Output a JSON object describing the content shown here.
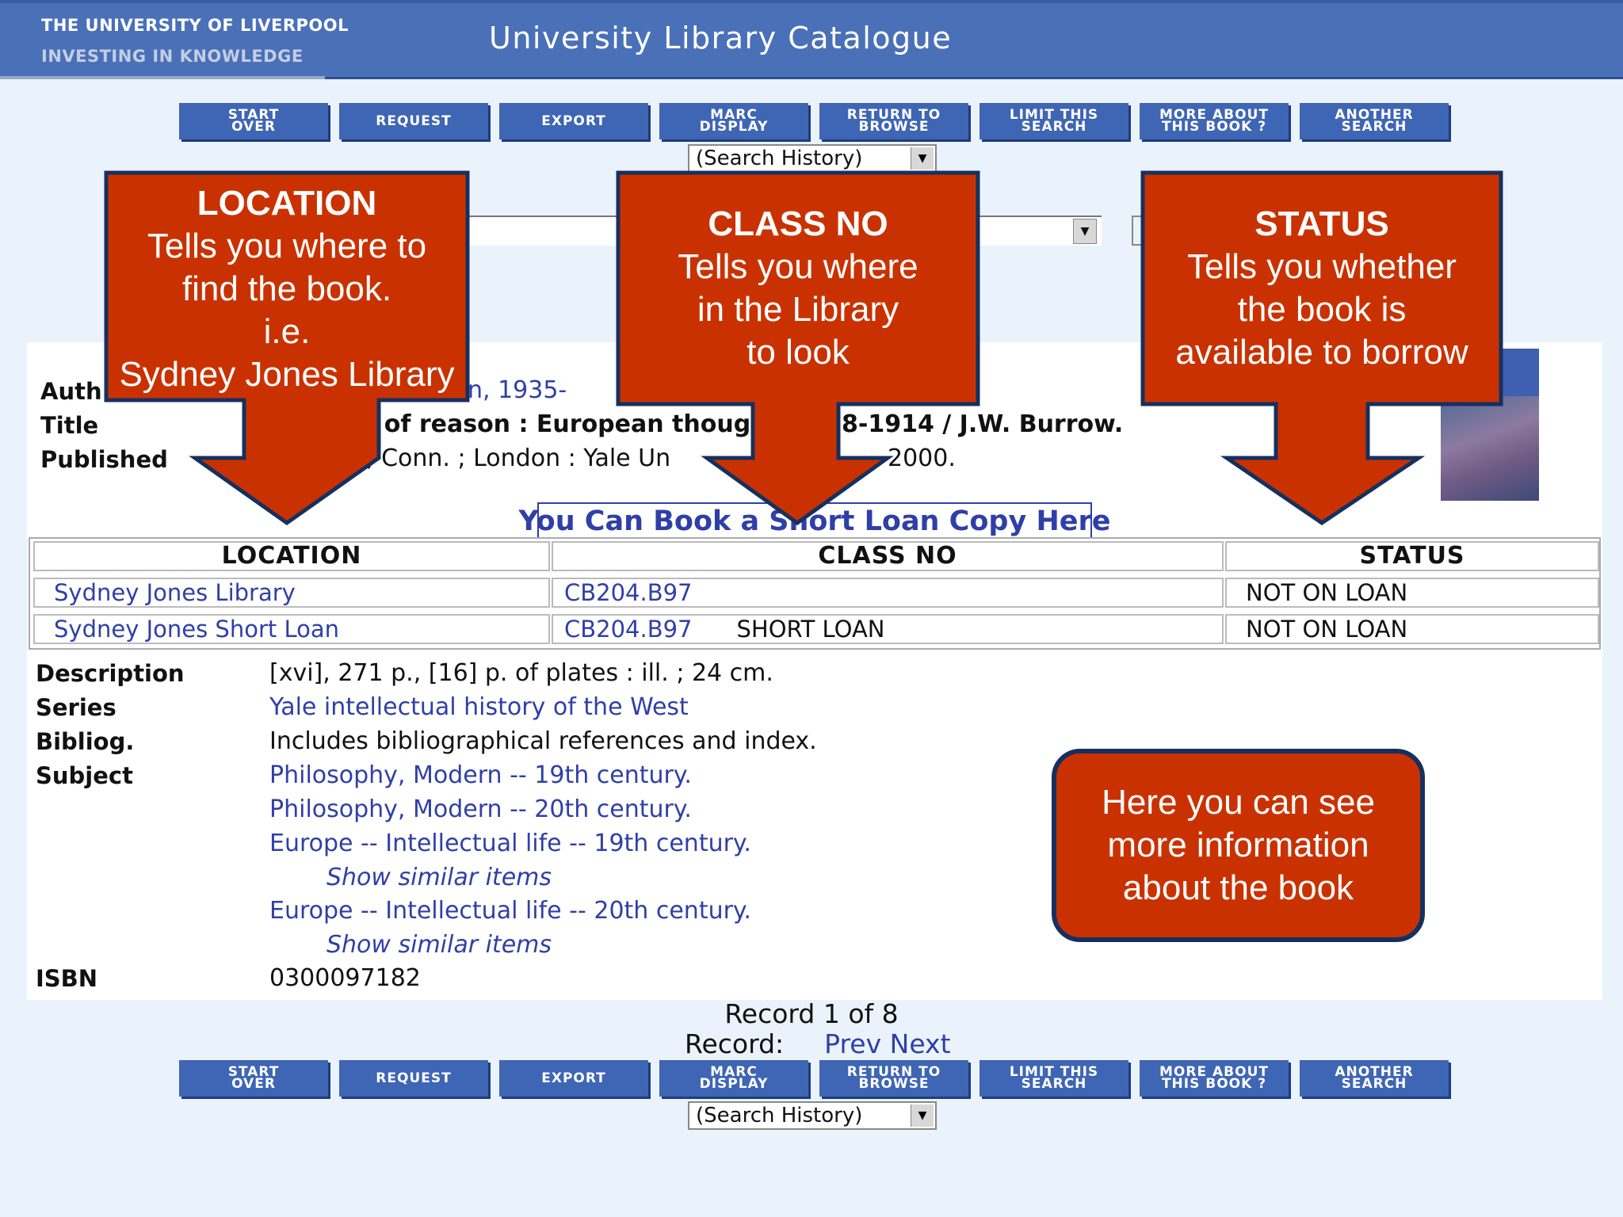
{
  "header": {
    "university": "THE UNIVERSITY OF LIVERPOOL",
    "tagline": "INVESTING IN KNOWLEDGE",
    "title": "University Library Catalogue"
  },
  "toolbar": {
    "buttons": [
      {
        "label": "Start\nOver"
      },
      {
        "label": "Request"
      },
      {
        "label": "Export"
      },
      {
        "label": "MARC\nDisplay"
      },
      {
        "label": "Return to\nBrowse"
      },
      {
        "label": "Limit This\nSearch"
      },
      {
        "label": "More About\nThis Book ?"
      },
      {
        "label": "Another\nSearch"
      }
    ],
    "search_history": "(Search History)"
  },
  "record": {
    "author_label": "Auth",
    "author_value": "n, 1935-",
    "title_label": "Title",
    "title_value_a": "isis of reason : European though",
    "title_value_b": "8-1914 / J.W. Burrow.",
    "published_label": "Published",
    "published_value_a": ", Conn. ; London : Yale Un",
    "published_value_b": "2000.",
    "short_loan_link": "You Can Book a Short Loan Copy Here"
  },
  "holdings": {
    "headers": [
      "LOCATION",
      "CLASS NO",
      "STATUS"
    ],
    "rows": [
      {
        "location": "Sydney Jones Library",
        "class_no": "CB204.B97",
        "note": "",
        "status": "NOT ON LOAN"
      },
      {
        "location": "Sydney Jones Short Loan",
        "class_no": "CB204.B97",
        "note": "SHORT LOAN",
        "status": "NOT ON LOAN"
      }
    ]
  },
  "details": {
    "description_label": "Description",
    "description": "[xvi], 271 p., [16] p. of plates : ill. ; 24 cm.",
    "series_label": "Series",
    "series": "Yale intellectual history of the West",
    "bibliog_label": "Bibliog.",
    "bibliog": "Includes bibliographical references and index.",
    "subject_label": "Subject",
    "subjects": [
      "Philosophy, Modern -- 19th century.",
      "Philosophy, Modern -- 20th century.",
      "Europe -- Intellectual life -- 19th century.",
      "Europe -- Intellectual life -- 20th century."
    ],
    "show_similar": "Show similar items",
    "isbn_label": "ISBN",
    "isbn": "0300097182"
  },
  "callouts": {
    "location": {
      "head": "LOCATION",
      "line1": "Tells you where to",
      "line2": "find the book.",
      "line3": "i.e.",
      "line4": "Sydney Jones Library"
    },
    "class_no": {
      "head": "CLASS NO",
      "line1": "Tells you where",
      "line2": "in the Library",
      "line3": "to look"
    },
    "status": {
      "head": "STATUS",
      "line1": "Tells you whether",
      "line2": "the book is",
      "line3": "available to borrow"
    },
    "info": {
      "line1": "Here you can see",
      "line2": "more information",
      "line3": "about the book"
    }
  },
  "navigation": {
    "record_count": "Record 1 of 8",
    "record_label": "Record:",
    "prev": "Prev",
    "next": "Next"
  },
  "colors": {
    "header_bg": "#4a70b8",
    "button_bg": "#3f66b4",
    "callout_red": "#c93200",
    "callout_border": "#16305e",
    "link": "#2f3fa8"
  }
}
